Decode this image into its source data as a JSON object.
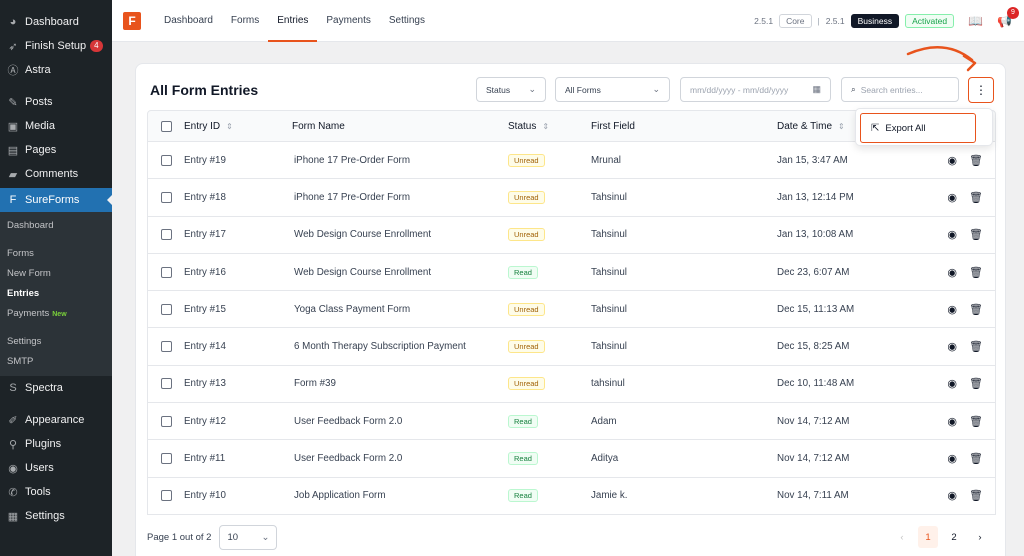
{
  "sidebar": {
    "items_top": [
      {
        "label": "Dashboard",
        "icon": "dashboard-icon",
        "glyph": "◕"
      },
      {
        "label": "Finish Setup",
        "icon": "rocket-icon",
        "glyph": "➶",
        "badge": "4"
      },
      {
        "label": "Astra",
        "icon": "astra-icon",
        "glyph": "Ⓐ"
      }
    ],
    "items_mid": [
      {
        "label": "Posts",
        "icon": "pushpin-icon",
        "glyph": "✎"
      },
      {
        "label": "Media",
        "icon": "media-icon",
        "glyph": "▣"
      },
      {
        "label": "Pages",
        "icon": "pages-icon",
        "glyph": "▤"
      },
      {
        "label": "Comments",
        "icon": "comments-icon",
        "glyph": "▰"
      }
    ],
    "sureforms": {
      "label": "SureForms",
      "icon": "sureforms-icon",
      "glyph": "F"
    },
    "submenu": [
      {
        "label": "Dashboard"
      },
      {
        "sep": true
      },
      {
        "label": "Forms"
      },
      {
        "label": "New Form"
      },
      {
        "label": "Entries",
        "current": true
      },
      {
        "label": "Payments",
        "new": "New"
      },
      {
        "sep": true
      },
      {
        "label": "Settings"
      },
      {
        "label": "SMTP"
      }
    ],
    "spectra": {
      "label": "Spectra",
      "icon": "spectra-icon",
      "glyph": "S"
    },
    "items_bottom": [
      {
        "label": "Appearance",
        "icon": "appearance-icon",
        "glyph": "✐"
      },
      {
        "label": "Plugins",
        "icon": "plugins-icon",
        "glyph": "⚲"
      },
      {
        "label": "Users",
        "icon": "users-icon",
        "glyph": "◉"
      },
      {
        "label": "Tools",
        "icon": "tools-icon",
        "glyph": "✆"
      },
      {
        "label": "Settings",
        "icon": "settings-icon",
        "glyph": "▦"
      }
    ]
  },
  "topbar": {
    "logo": "F",
    "nav": [
      "Dashboard",
      "Forms",
      "Entries",
      "Payments",
      "Settings"
    ],
    "active_nav": "Entries",
    "core_version": "2.5.1",
    "core_label": "Core",
    "separator": "|",
    "business_version": "2.5.1",
    "business_label": "Business",
    "activated_label": "Activated",
    "notifications_count": "9"
  },
  "card": {
    "title": "All Form Entries",
    "status_filter": "Status",
    "forms_filter": "All Forms",
    "date_placeholder": "mm/dd/yyyy - mm/dd/yyyy",
    "search_placeholder": "Search entries...",
    "more_glyph": "⋮"
  },
  "table": {
    "headers": {
      "id": "Entry ID",
      "name": "Form Name",
      "status": "Status",
      "first": "First Field",
      "date": "Date & Time"
    },
    "rows": [
      {
        "id": "Entry #19",
        "name": "iPhone 17 Pre-Order Form",
        "status": "Unread",
        "first": "Mrunal",
        "date": "Jan 15, 3:47 AM"
      },
      {
        "id": "Entry #18",
        "name": "iPhone 17 Pre-Order Form",
        "status": "Unread",
        "first": "Tahsinul",
        "date": "Jan 13, 12:14 PM"
      },
      {
        "id": "Entry #17",
        "name": "Web Design Course Enrollment",
        "status": "Unread",
        "first": "Tahsinul",
        "date": "Jan 13, 10:08 AM"
      },
      {
        "id": "Entry #16",
        "name": "Web Design Course Enrollment",
        "status": "Read",
        "first": "Tahsinul",
        "date": "Dec 23, 6:07 AM"
      },
      {
        "id": "Entry #15",
        "name": "Yoga Class Payment Form",
        "status": "Unread",
        "first": "Tahsinul",
        "date": "Dec 15, 11:13 AM"
      },
      {
        "id": "Entry #14",
        "name": "6 Month Therapy Subscription Payment",
        "status": "Unread",
        "first": "Tahsinul",
        "date": "Dec 15, 8:25 AM"
      },
      {
        "id": "Entry #13",
        "name": "Form #39",
        "status": "Unread",
        "first": "tahsinul",
        "date": "Dec 10, 11:48 AM"
      },
      {
        "id": "Entry #12",
        "name": "User Feedback Form 2.0",
        "status": "Read",
        "first": "Adam",
        "date": "Nov 14, 7:12 AM"
      },
      {
        "id": "Entry #11",
        "name": "User Feedback Form 2.0",
        "status": "Read",
        "first": "Aditya",
        "date": "Nov 14, 7:12 AM"
      },
      {
        "id": "Entry #10",
        "name": "Job Application Form",
        "status": "Read",
        "first": "Jamie k.",
        "date": "Nov 14, 7:11 AM"
      }
    ]
  },
  "footer": {
    "page_info": "Page 1 out of 2",
    "per_page": "10",
    "pages": [
      "1",
      "2"
    ],
    "current_page": "1"
  },
  "dropdown": {
    "export_label": "Export All"
  },
  "colors": {
    "accent": "#e8531c",
    "wp_sidebar": "#1d2327",
    "wp_active": "#2271b1"
  }
}
